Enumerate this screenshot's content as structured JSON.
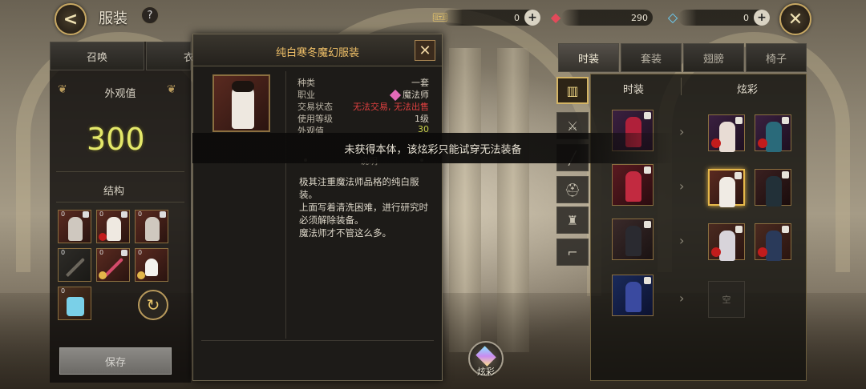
{
  "header": {
    "title": "服装",
    "help": "?",
    "back": "<",
    "close": "✕"
  },
  "currencies": [
    {
      "icon": "ticket-icon",
      "value": "0",
      "plus": "+"
    },
    {
      "icon": "red-crystal-icon",
      "value": "290"
    },
    {
      "icon": "diamond-icon",
      "value": "0",
      "plus": "+"
    }
  ],
  "left": {
    "tabs": [
      "召唤",
      "衣"
    ],
    "looks_label": "外观值",
    "looks_value": "300",
    "structure_label": "结构",
    "slot_counts": [
      "0",
      "0",
      "0",
      "0",
      "0",
      "0",
      "0"
    ],
    "save": "保存",
    "refresh_icon": "refresh-icon"
  },
  "popup": {
    "title": "纯白寒冬魔幻服装",
    "close": "✕",
    "rows": [
      {
        "key": "种类",
        "value": "一套"
      },
      {
        "key": "职业",
        "value": "魔法师"
      },
      {
        "key": "交易状态",
        "value": "无法交易, 无法出售"
      },
      {
        "key": "使用等级",
        "value": "1级"
      },
      {
        "key": "外观值",
        "value": "30"
      }
    ],
    "desc_tab": "说明",
    "description": "极其注重魔法师品格的纯白服装。\n上面写着清洗困难，进行研究时必须解除装备。\n魔法师才不管这么多。"
  },
  "banner": "未获得本体，该炫彩只能试穿无法装备",
  "right": {
    "tabs": [
      "时装",
      "套装",
      "翅膀",
      "椅子"
    ],
    "active_tab": "时装",
    "col_headers": [
      "时装",
      "炫彩"
    ],
    "empty_label": "空"
  },
  "color_button": "炫彩",
  "colors": {
    "accent_gold": "#d4b464",
    "looks_yellow": "#e4e86a",
    "title_orange": "#f0c068",
    "warn_red": "#e04040"
  }
}
